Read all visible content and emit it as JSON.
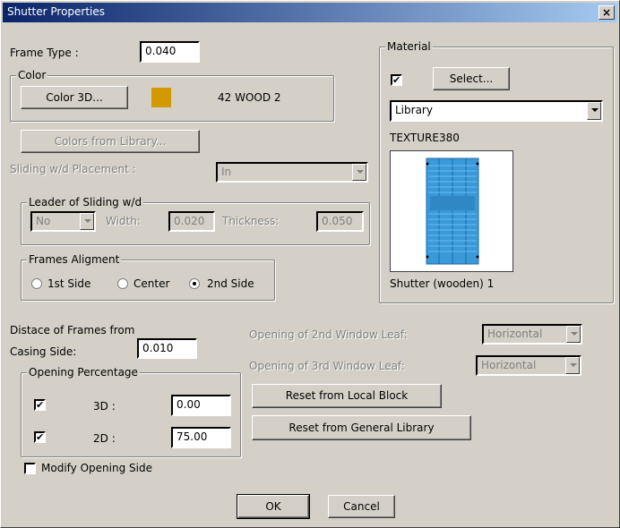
{
  "window": {
    "title": "Shutter Properties",
    "close": "×"
  },
  "frame_type": {
    "label": "Frame Type :",
    "value": "0.040"
  },
  "color": {
    "legend": "Color",
    "button": "Color 3D...",
    "swatch": "#d29a00",
    "name": "42 WOOD 2"
  },
  "colors_from_library": "Colors from Library...",
  "sliding_placement": {
    "label": "Sliding w/d Placement :",
    "value": "In"
  },
  "leader": {
    "legend": "Leader of Sliding w/d",
    "select": "No",
    "width_label": "Width:",
    "width_value": "0.020",
    "thickness_label": "Thickness:",
    "thickness_value": "0.050"
  },
  "frames_alignment": {
    "legend": "Frames Aligment",
    "options": [
      "1st Side",
      "Center",
      "2nd Side"
    ],
    "selected": "2nd Side"
  },
  "material": {
    "legend": "Material",
    "check": "✔",
    "select_button": "Select...",
    "library_value": "Library",
    "texture": "TEXTURE380",
    "caption": "Shutter (wooden) 1",
    "shutter_color": "#3a9ad9"
  },
  "distance": {
    "label1": "Distace of Frames from",
    "label2": "Casing Side:",
    "value": "0.010"
  },
  "opening": {
    "legend": "Opening Percentage",
    "rows": [
      {
        "check": "✔",
        "label": "3D :",
        "value": "0.00"
      },
      {
        "check": "✔",
        "label": "2D :",
        "value": "75.00"
      }
    ]
  },
  "modify_side": "Modify Opening Side",
  "leaf2": {
    "label": "Opening of 2nd Window Leaf:",
    "value": "Horizontal"
  },
  "leaf3": {
    "label": "Opening of 3rd Window Leaf:",
    "value": "Horizontal"
  },
  "reset_local": "Reset from Local Block",
  "reset_general": "Reset from General Library",
  "ok": "OK",
  "cancel": "Cancel"
}
